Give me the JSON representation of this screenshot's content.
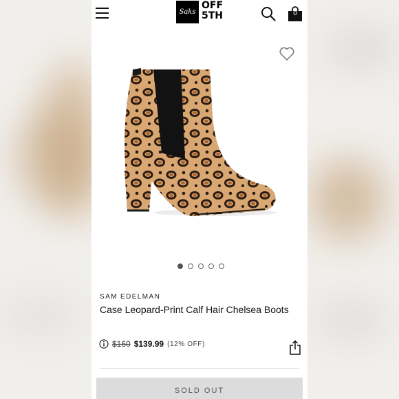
{
  "brand_logo": {
    "script_text": "Saks",
    "line1": "OFF",
    "line2": "5TH"
  },
  "header": {
    "cart_count": "0",
    "icons": [
      "hamburger-menu-icon",
      "search-icon",
      "shopping-bag-icon"
    ]
  },
  "gallery": {
    "image_count": 5,
    "active_index": 0
  },
  "product": {
    "brand": "SAM EDELMAN",
    "title": "Case Leopard-Print Calf Hair Chelsea Boots",
    "original_price": "$160",
    "sale_price": "$139.99",
    "discount": "(12% OFF)"
  },
  "actions": {
    "sold_out_label": "SOLD OUT"
  },
  "colors": {
    "text": "#111111",
    "button_bg": "#dcdcdc",
    "button_text": "#555555",
    "leopard_base": "#d9a772",
    "leopard_spot": "#2a1a10"
  }
}
